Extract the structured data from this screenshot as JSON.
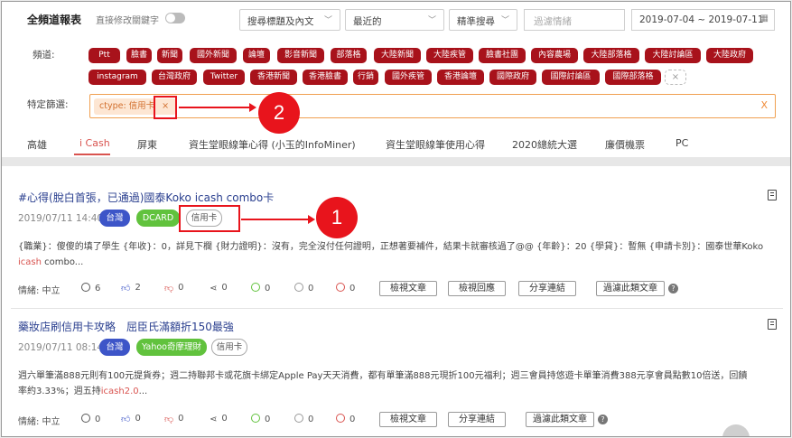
{
  "header": {
    "title": "全頻道報表",
    "toggle_label": "直接修改關鍵字",
    "search_scope": "搜尋標題及內文",
    "sort": "最近的",
    "search_mode": "精準搜尋",
    "filter_placeholder": "過濾情緒",
    "date_range": "2019-07-04 ~ 2019-07-11"
  },
  "channels": {
    "label": "頻道:",
    "row1": [
      "Ptt",
      "臉書",
      "新聞",
      "國外新聞",
      "論壇",
      "影音新聞",
      "部落格",
      "大陸新聞",
      "大陸疾管",
      "臉書社團",
      "內容農場",
      "大陸部落格",
      "大陸討論區",
      "大陸政府"
    ],
    "row2": [
      "instagram",
      "台灣政府",
      "Twitter",
      "香港新聞",
      "香港臉書",
      "行銷",
      "國外疾管",
      "香港論壇",
      "國際政府",
      "國際討論區",
      "國際部落格"
    ],
    "remove_symbol": "×"
  },
  "filter": {
    "label": "特定篩選:",
    "chip": "ctype: 信用卡",
    "chip_remove": "×",
    "clear": "X"
  },
  "tabs": [
    "高雄",
    "i Cash",
    "屏東",
    "資生堂眼線筆心得 (小玉的InfoMiner)",
    "資生堂眼線筆使用心得",
    "2020總統大選",
    "廉價機票",
    "PC"
  ],
  "posts": [
    {
      "title": "#心得(脫白首張，已通過)國泰Koko icash combo卡",
      "date": "2019/07/11 14:40",
      "tags": [
        "台灣",
        "DCARD",
        "信用卡"
      ],
      "excerpt_line1": "{職業}：傻傻的填了學生 {年收}：0，詳見下欄 {財力證明}：沒有，完全沒付任何證明，正想著要補件，結果卡就審核過了@@ {年齡}：20 {學貸}：暫無 {申請卡別}：國泰世華Koko",
      "excerpt_hl": "icash",
      "excerpt_tail": " combo...",
      "sentiment": "情緒: 中立",
      "comments": "6",
      "likes": "2",
      "dislikes": "0",
      "shares": "0",
      "happy": "0",
      "neutral": "0",
      "angry": "0",
      "buttons": [
        "檢視文章",
        "檢視回應",
        "分享連結",
        "過濾此類文章"
      ]
    },
    {
      "title": "藥妝店刷信用卡攻略　屈臣氏滿額折150最強",
      "date": "2019/07/11 08:14",
      "tags": [
        "台灣",
        "Yahoo奇摩理財",
        "信用卡"
      ],
      "excerpt_line1": "週六單筆滿888元則有100元提貨券；週二持聯邦卡或花旗卡綁定Apple Pay天天消費，都有單筆滿888元現折100元福利；週三會員持悠遊卡單筆消費388元享會員點數10倍送，回饋",
      "excerpt_line2": "率約3.33%；週五持",
      "excerpt_hl": "icash2.0",
      "excerpt_tail": "...",
      "sentiment": "情緒: 中立",
      "comments": "0",
      "likes": "0",
      "dislikes": "0",
      "shares": "0",
      "happy": "0",
      "neutral": "0",
      "angry": "0",
      "buttons": [
        "檢視文章",
        "分享連結",
        "過濾此類文章"
      ]
    }
  ],
  "annotations": [
    "1",
    "2"
  ],
  "colors": {
    "channel_chip": "#a8121b",
    "accent": "#d9534f",
    "annotation": "#e8141c",
    "tag_blue": "#3d55c8",
    "tag_green": "#61c23d"
  }
}
